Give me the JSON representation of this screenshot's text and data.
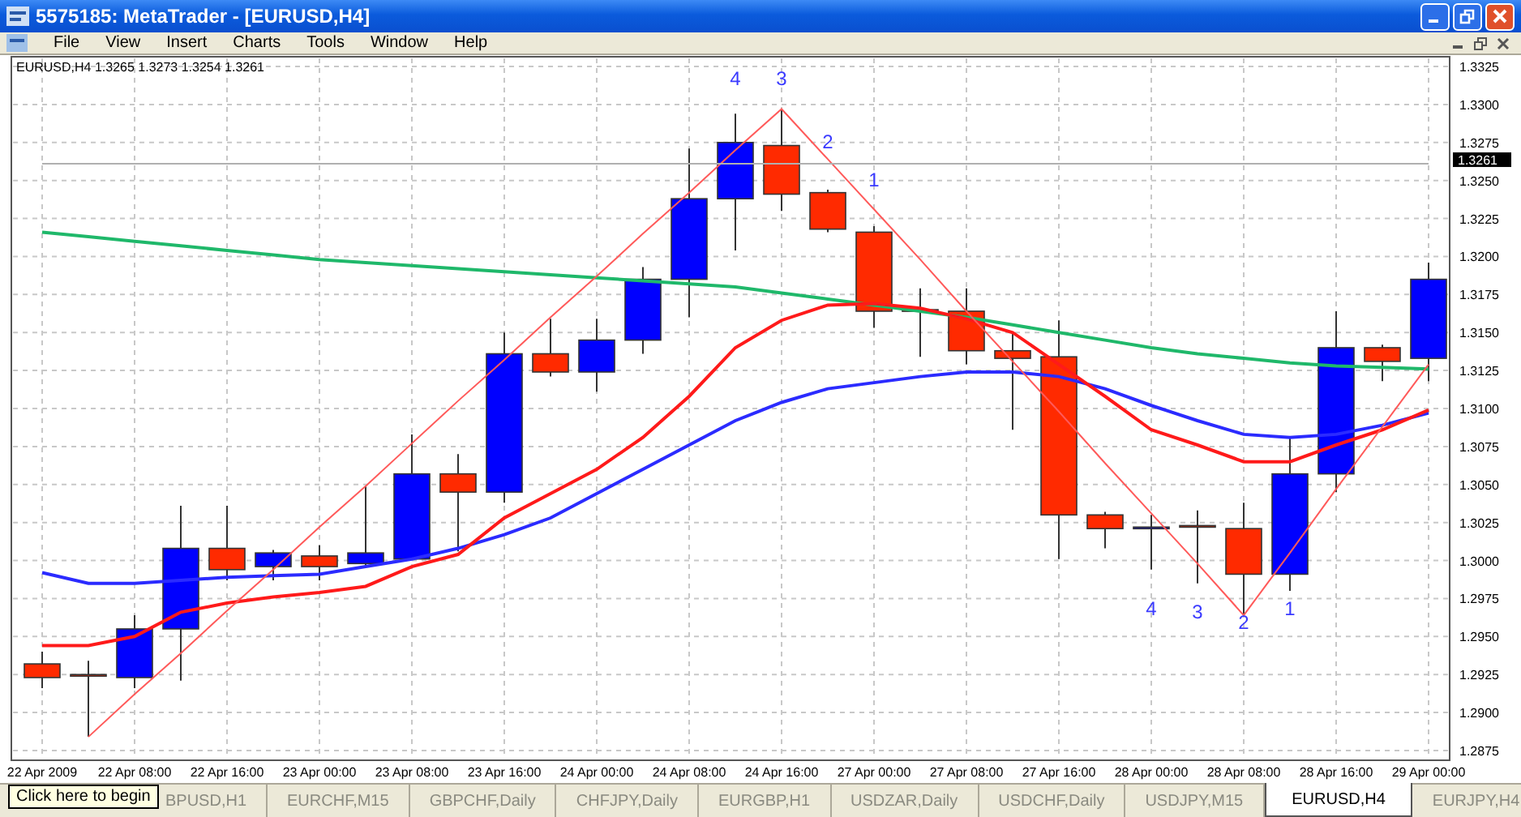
{
  "window": {
    "title": "5575185: MetaTrader - [EURUSD,H4]"
  },
  "menu": [
    "File",
    "View",
    "Insert",
    "Charts",
    "Tools",
    "Window",
    "Help"
  ],
  "chart": {
    "chart_data": {
      "type": "line",
      "title": "EURUSD,H4  1.3265 1.3273 1.3254 1.3261",
      "grid": true,
      "categories": [
        "22 Apr 2009",
        null,
        "22 Apr 08:00",
        null,
        "22 Apr 16:00",
        null,
        "23 Apr 00:00",
        null,
        "23 Apr 08:00",
        null,
        "23 Apr 16:00",
        null,
        "24 Apr 00:00",
        null,
        "24 Apr 08:00",
        null,
        "24 Apr 16:00",
        null,
        "27 Apr 00:00",
        null,
        "27 Apr 08:00",
        null,
        "27 Apr 16:00",
        null,
        "28 Apr 00:00",
        null,
        "28 Apr 08:00",
        null,
        "28 Apr 16:00",
        null,
        "29 Apr 00:00"
      ],
      "ylim": [
        1.2875,
        1.3325
      ],
      "yticks": [
        {
          "value": 1.3325,
          "label": "1.3325"
        },
        {
          "value": 1.33,
          "label": "1.3300"
        },
        {
          "value": 1.3275,
          "label": "1.3275"
        },
        {
          "value": 1.325,
          "label": "1.3250"
        },
        {
          "value": 1.3225,
          "label": "1.3225"
        },
        {
          "value": 1.32,
          "label": "1.3200"
        },
        {
          "value": 1.3175,
          "label": "1.3175"
        },
        {
          "value": 1.315,
          "label": "1.3150"
        },
        {
          "value": 1.3125,
          "label": "1.3125"
        },
        {
          "value": 1.31,
          "label": "1.3100"
        },
        {
          "value": 1.3075,
          "label": "1.3075"
        },
        {
          "value": 1.305,
          "label": "1.3050"
        },
        {
          "value": 1.3025,
          "label": "1.3025"
        },
        {
          "value": 1.3,
          "label": "1.3000"
        },
        {
          "value": 1.2975,
          "label": "1.2975"
        },
        {
          "value": 1.295,
          "label": "1.2950"
        },
        {
          "value": 1.2925,
          "label": "1.2925"
        },
        {
          "value": 1.29,
          "label": "1.2900"
        },
        {
          "value": 1.2875,
          "label": "1.2875"
        }
      ],
      "series": [
        {
          "color": "#1fb86a",
          "values": [
            1.3216,
            1.3213,
            1.321,
            1.3207,
            1.3204,
            1.3201,
            1.3198,
            1.3196,
            1.3194,
            1.3192,
            1.319,
            1.3188,
            1.3186,
            1.3184,
            1.3182,
            1.318,
            1.3176,
            1.3172,
            1.3168,
            1.3164,
            1.316,
            1.3155,
            1.315,
            1.3145,
            1.314,
            1.3136,
            1.3133,
            1.313,
            1.3128,
            1.3127,
            1.3126
          ]
        },
        {
          "color": "#2b2bff",
          "values": [
            1.2992,
            1.2985,
            1.2985,
            1.2987,
            1.2989,
            1.299,
            1.2991,
            1.2996,
            1.3001,
            1.3008,
            1.3017,
            1.3028,
            1.3044,
            1.306,
            1.3076,
            1.3092,
            1.3104,
            1.3113,
            1.3117,
            1.3121,
            1.3124,
            1.3124,
            1.3121,
            1.3113,
            1.3102,
            1.3092,
            1.3083,
            1.3081,
            1.3083,
            1.3089,
            1.3097
          ]
        },
        {
          "color": "#ff1a1a",
          "values": [
            1.2944,
            1.2944,
            1.295,
            1.2966,
            1.2972,
            1.2976,
            1.2979,
            1.2983,
            1.2996,
            1.3004,
            1.3028,
            1.3044,
            1.306,
            1.3081,
            1.3108,
            1.314,
            1.3158,
            1.3168,
            1.3169,
            1.3166,
            1.3159,
            1.315,
            1.3129,
            1.3108,
            1.3086,
            1.3076,
            1.3065,
            1.3065,
            1.3076,
            1.3086,
            1.3099
          ]
        },
        {
          "color": "#ff5a5a",
          "values": [
            null,
            1.2884,
            1.2912,
            1.2939,
            1.2967,
            1.2994,
            1.3022,
            1.3049,
            1.3077,
            1.3105,
            1.3132,
            1.316,
            1.3187,
            1.3215,
            1.3242,
            1.327,
            1.3297,
            1.3264,
            1.3231,
            1.3198,
            1.3164,
            1.3131,
            1.3098,
            1.3064,
            1.3031,
            1.2998,
            1.2964,
            1.3005,
            1.3047,
            1.3088,
            1.3129
          ]
        },
        {
          "name": "1.3261",
          "color": "#b0b0b0",
          "values": [
            1.3261,
            1.3261,
            1.3261,
            1.3261,
            1.3261,
            1.3261,
            1.3261,
            1.3261,
            1.3261,
            1.3261,
            1.3261,
            1.3261,
            1.3261,
            1.3261,
            1.3261,
            1.3261,
            1.3261,
            1.3261,
            1.3261,
            1.3261,
            1.3261,
            1.3261,
            1.3261,
            1.3261,
            1.3261,
            1.3261,
            1.3261,
            1.3261,
            1.3261,
            1.3261,
            1.3261
          ]
        }
      ],
      "annotations": [
        "4",
        "3",
        "2",
        "1",
        "4",
        "3",
        "2",
        "1"
      ]
    }
  },
  "tooltip": "Click here to begin",
  "tabs": [
    {
      "label": "BPUSD,H1",
      "selected": false
    },
    {
      "label": "EURCHF,M15",
      "selected": false
    },
    {
      "label": "GBPCHF,Daily",
      "selected": false
    },
    {
      "label": "CHFJPY,Daily",
      "selected": false
    },
    {
      "label": "EURGBP,H1",
      "selected": false
    },
    {
      "label": "USDZAR,Daily",
      "selected": false
    },
    {
      "label": "USDCHF,Daily",
      "selected": false
    },
    {
      "label": "USDJPY,M15",
      "selected": false
    },
    {
      "label": "EURUSD,H4",
      "selected": true
    },
    {
      "label": "EURJPY,H4",
      "selected": false
    }
  ]
}
